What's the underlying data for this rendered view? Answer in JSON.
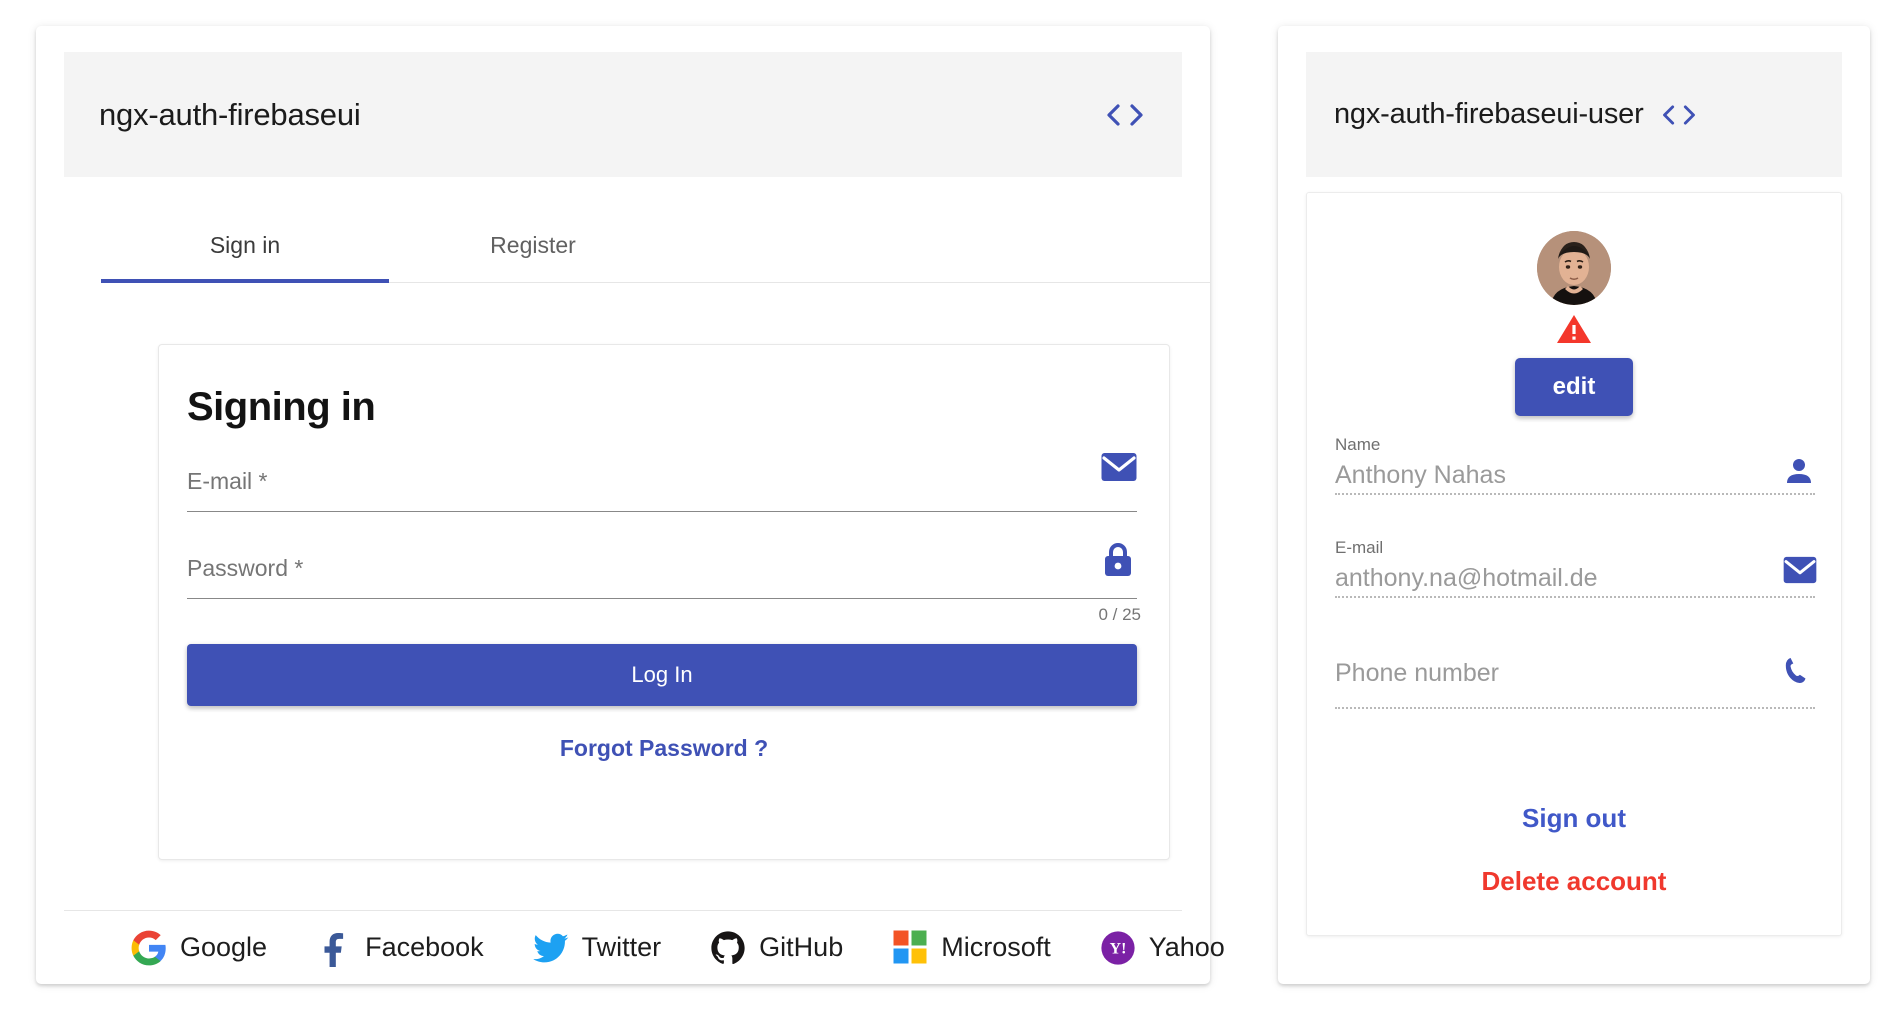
{
  "auth_card": {
    "header": {
      "title": "ngx-auth-firebaseui",
      "code_icon": "code-brackets-icon"
    },
    "tabs": [
      {
        "label": "Sign in",
        "active": true
      },
      {
        "label": "Register",
        "active": false
      }
    ],
    "signin_panel": {
      "title": "Signing in",
      "email_field": {
        "label": "E-mail *",
        "value": "",
        "icon": "email-icon"
      },
      "password_field": {
        "label": "Password *",
        "value": "",
        "icon": "lock-icon",
        "counter": "0 / 25"
      },
      "login_button": "Log In",
      "forgot_link": "Forgot Password ?"
    },
    "providers": [
      {
        "label": "Google",
        "icon": "google-icon"
      },
      {
        "label": "Facebook",
        "icon": "facebook-icon"
      },
      {
        "label": "Twitter",
        "icon": "twitter-icon"
      },
      {
        "label": "GitHub",
        "icon": "github-icon"
      },
      {
        "label": "Microsoft",
        "icon": "microsoft-icon"
      },
      {
        "label": "Yahoo",
        "icon": "yahoo-icon"
      }
    ]
  },
  "user_card": {
    "header": {
      "title": "ngx-auth-firebaseui-user",
      "code_icon": "code-brackets-icon"
    },
    "profile": {
      "avatar": "user-avatar-photo",
      "warning_badge": "warning-triangle-icon",
      "edit_button": "edit",
      "name_field": {
        "label": "Name",
        "value": "Anthony Nahas",
        "icon": "person-icon"
      },
      "email_field": {
        "label": "E-mail",
        "value": "anthony.na@hotmail.de",
        "icon": "email-icon"
      },
      "phone_field": {
        "label": "",
        "value": "Phone number",
        "icon": "phone-icon"
      },
      "signout_link": "Sign out",
      "delete_link": "Delete account"
    }
  },
  "colors": {
    "primary": "#3f51b5",
    "link": "#4058c8",
    "danger": "#f0382d",
    "header_bg": "#f4f4f4",
    "muted_text": "#9a9a9a"
  }
}
